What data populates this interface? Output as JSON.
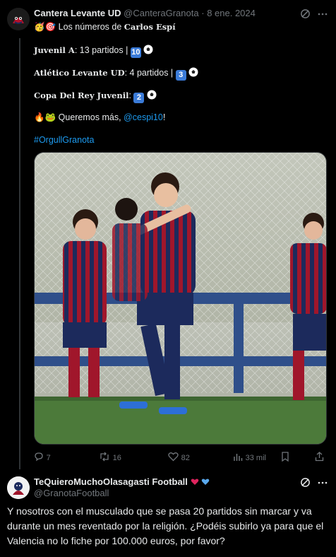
{
  "tweet": {
    "author_name": "Cantera Levante UD",
    "handle": "@CanteraGranota",
    "separator": "·",
    "date": "8 ene. 2024",
    "intro_text": "Los números de",
    "player_name": "Carlos Espí",
    "line1_label": "Juvenil A",
    "line1_value": ": 13 partidos |",
    "line1_badge": "10",
    "line2_label": "Atlético Levante UD",
    "line2_value": ": 4 partidos |",
    "line2_badge": "3",
    "line3_label": "Copa Del Rey Juvenil",
    "line3_value": ":",
    "line3_badge": "2",
    "closing_text": "Queremos más,",
    "mention": "@cespi10",
    "exclaim": "!",
    "hashtag": "#OrgullGranota",
    "stats": {
      "replies": "7",
      "retweets": "16",
      "likes": "82",
      "views": "33 mil"
    }
  },
  "reply": {
    "author_name": "TeQuieroMuchoOlasagasti Football",
    "handle": "@GranotaFootball",
    "text": "Y nosotros con el musculado que se pasa 20 partidos sin marcar y va durante un mes reventado por la religión. ¿Podéis subirlo ya para que el Valencia no lo fiche por 100.000 euros, por favor?"
  },
  "colors": {
    "link": "#1d9bf0",
    "muted": "#71767b",
    "kit_red": "#a0162b",
    "kit_blue": "#1c2a5c"
  }
}
